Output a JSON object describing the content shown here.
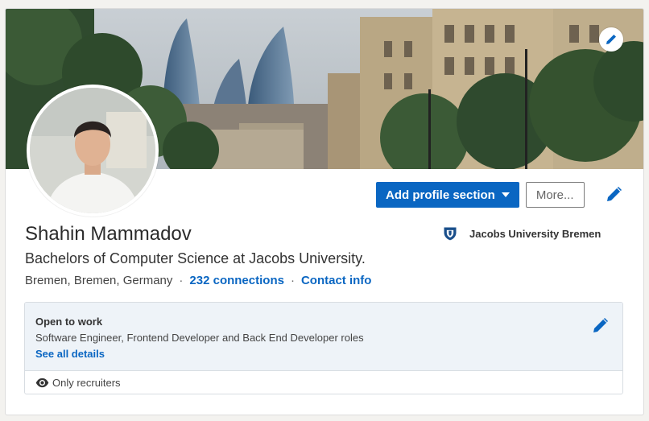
{
  "profile": {
    "name": "Shahin Mammadov",
    "headline": "Bachelors of Computer Science at Jacobs University.",
    "location": "Bremen, Bremen, Germany",
    "separator": "·",
    "connections": "232 connections",
    "contact_info": "Contact info"
  },
  "actions": {
    "add_section": "Add profile section",
    "more": "More..."
  },
  "education": {
    "school": "Jacobs University Bremen"
  },
  "open_to_work": {
    "title": "Open to work",
    "roles": "Software Engineer, Frontend Developer and Back End Developer roles",
    "details_link": "See all details",
    "visibility": "Only recruiters"
  },
  "icons": {
    "cover_edit": "pencil-icon",
    "intro_edit": "pencil-icon",
    "open_to_work_edit": "pencil-icon",
    "visibility": "eye-icon",
    "school_logo": "shield-icon",
    "dropdown": "caret-down-icon"
  },
  "colors": {
    "accent": "#0a66c2",
    "text": "#2b2b2b",
    "panel": "#eef3f8"
  }
}
